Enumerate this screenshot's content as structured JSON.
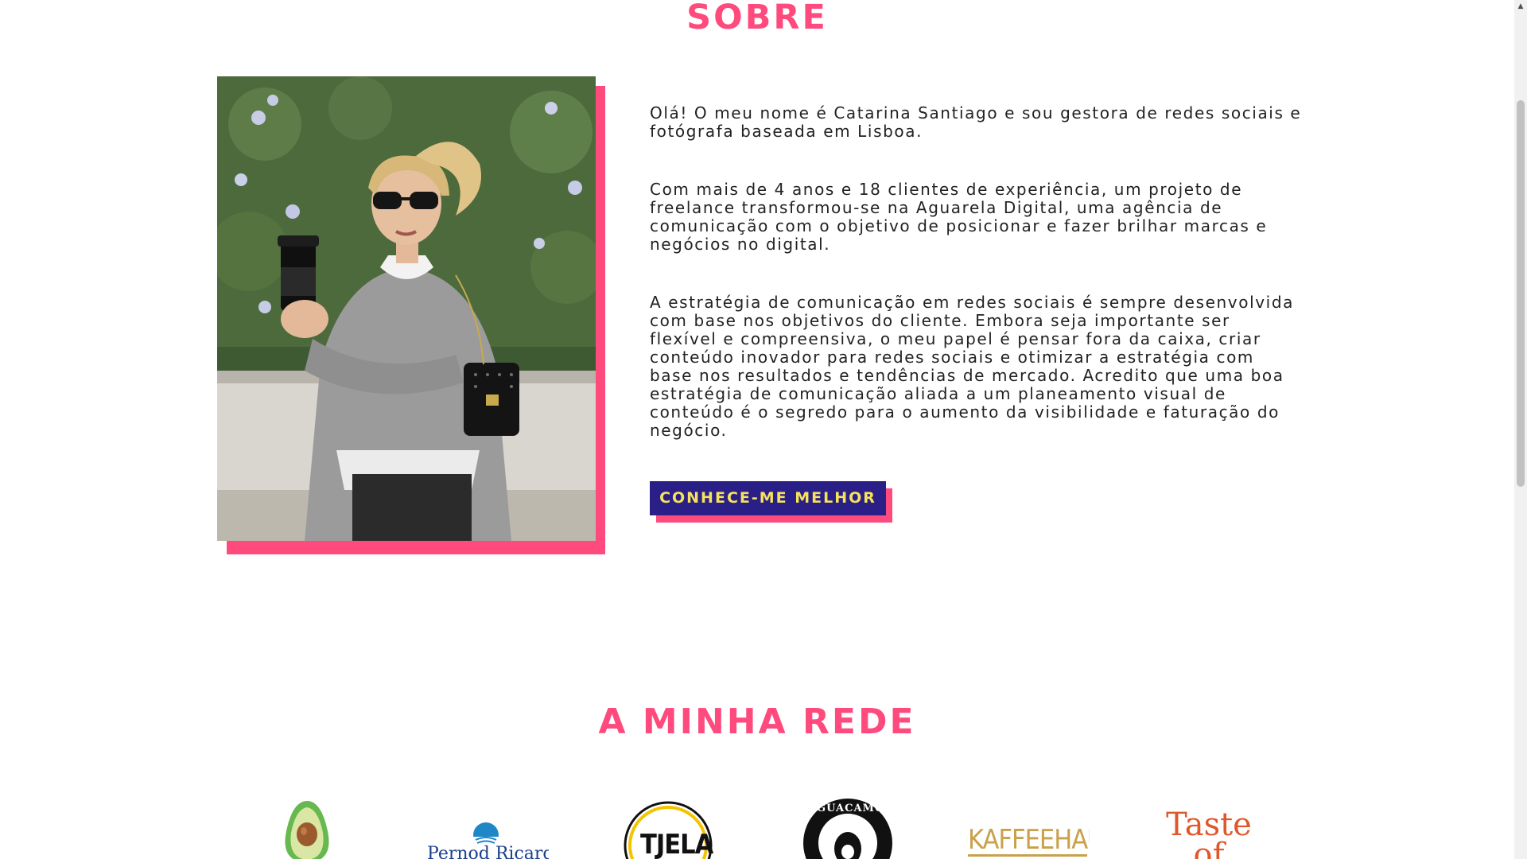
{
  "colors": {
    "accent": "#ff4a7d",
    "cta_background": "#2a1f86",
    "cta_text": "#f5e25c",
    "body_text": "#222222"
  },
  "about": {
    "title": "SOBRE",
    "paragraphs": [
      "Olá! O meu nome é Catarina Santiago e sou gestora de redes sociais e fotógrafa baseada em Lisboa.",
      "Com mais de 4 anos e 18 clientes de experiência, um projeto de freelance transformou-se na Aguarela Digital, uma agência de comunicação com o objetivo de posicionar e fazer brilhar marcas e negócios no digital.",
      "A estratégia de comunicação em redes sociais é sempre desenvolvida com base nos objetivos do cliente. Embora seja importante ser flexível e compreensiva, o meu papel é pensar fora da caixa, criar conteúdo inovador para redes sociais e otimizar a estratégia com base nos resultados e tendências de mercado. Acredito que uma boa estratégia de comunicação aliada a um planeamento visual de conteúdo é o segredo para o aumento da visibilidade e faturação do negócio."
    ],
    "cta_label": "CONHECE-ME MELHOR"
  },
  "network": {
    "title": "A MINHA REDE",
    "logos": [
      {
        "name": "avocado-logo",
        "text": ""
      },
      {
        "name": "pernod-ricard-logo",
        "text": "Pernod Ricard"
      },
      {
        "name": "tjela-logo",
        "text": "TJELA"
      },
      {
        "name": "guacamole-logo",
        "text": "GUACAMOLE"
      },
      {
        "name": "kaffeehaus-logo",
        "text": "KAFFEEHAUS"
      },
      {
        "name": "taste-of-india-logo",
        "text": "Taste of India"
      }
    ]
  },
  "icons": {
    "scroll_up": "scroll-up-arrow-icon"
  }
}
